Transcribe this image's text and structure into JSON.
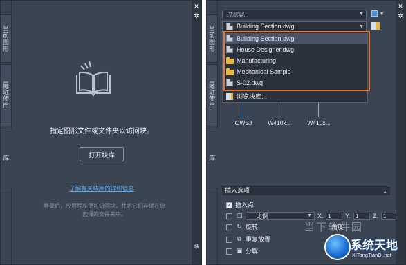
{
  "left": {
    "tabs": [
      "当前图形",
      "最近使用",
      "库"
    ],
    "message": "指定图形文件或文件夹以访问块。",
    "open_button": "打开块库",
    "learn_link": "了解有关块库的详细信息",
    "login_msg": "登录后，应用程序便可访问块，并将它们存储在您选择的文件夹中。",
    "strip_label": "块",
    "close_icon": "close-icon",
    "settings_icon": "gear-icon"
  },
  "right": {
    "tabs": [
      "当前图形",
      "最近使用",
      "库"
    ],
    "filter_placeholder": "过滤器...",
    "source_selected": "Building Section.dwg",
    "dropdown_items": [
      {
        "label": "Building Section.dwg",
        "icon": "doc-icon"
      },
      {
        "label": "House Designer.dwg",
        "icon": "doc-icon"
      },
      {
        "label": "Manufacturing",
        "icon": "folder-icon"
      },
      {
        "label": "Mechanical Sample",
        "icon": "folder-icon"
      },
      {
        "label": "S-02.dwg",
        "icon": "doc-icon"
      },
      {
        "label": "浏览块库...",
        "icon": "library-icon"
      }
    ],
    "blocks": [
      "OWSJ",
      "W410x...",
      "W410x..."
    ],
    "insert_header": "插入选项",
    "options": {
      "insertion_point": "插入点",
      "scale_label": "比例",
      "x_label": "X.",
      "x_value": "1",
      "y_label": "Y.",
      "y_value": "1",
      "z_label": "Z.",
      "z_value": "1",
      "rotation": "旋转",
      "angle_label": "角度",
      "repeat": "重复放置",
      "explode": "分解"
    }
  },
  "watermark": "当下软件园",
  "logo": {
    "title": "系统天地",
    "subtitle": "XiTongTianDi.net"
  },
  "colors": {
    "panel_bg": "#3b4453",
    "highlight": "#e6782e",
    "link": "#5ea6ea"
  }
}
